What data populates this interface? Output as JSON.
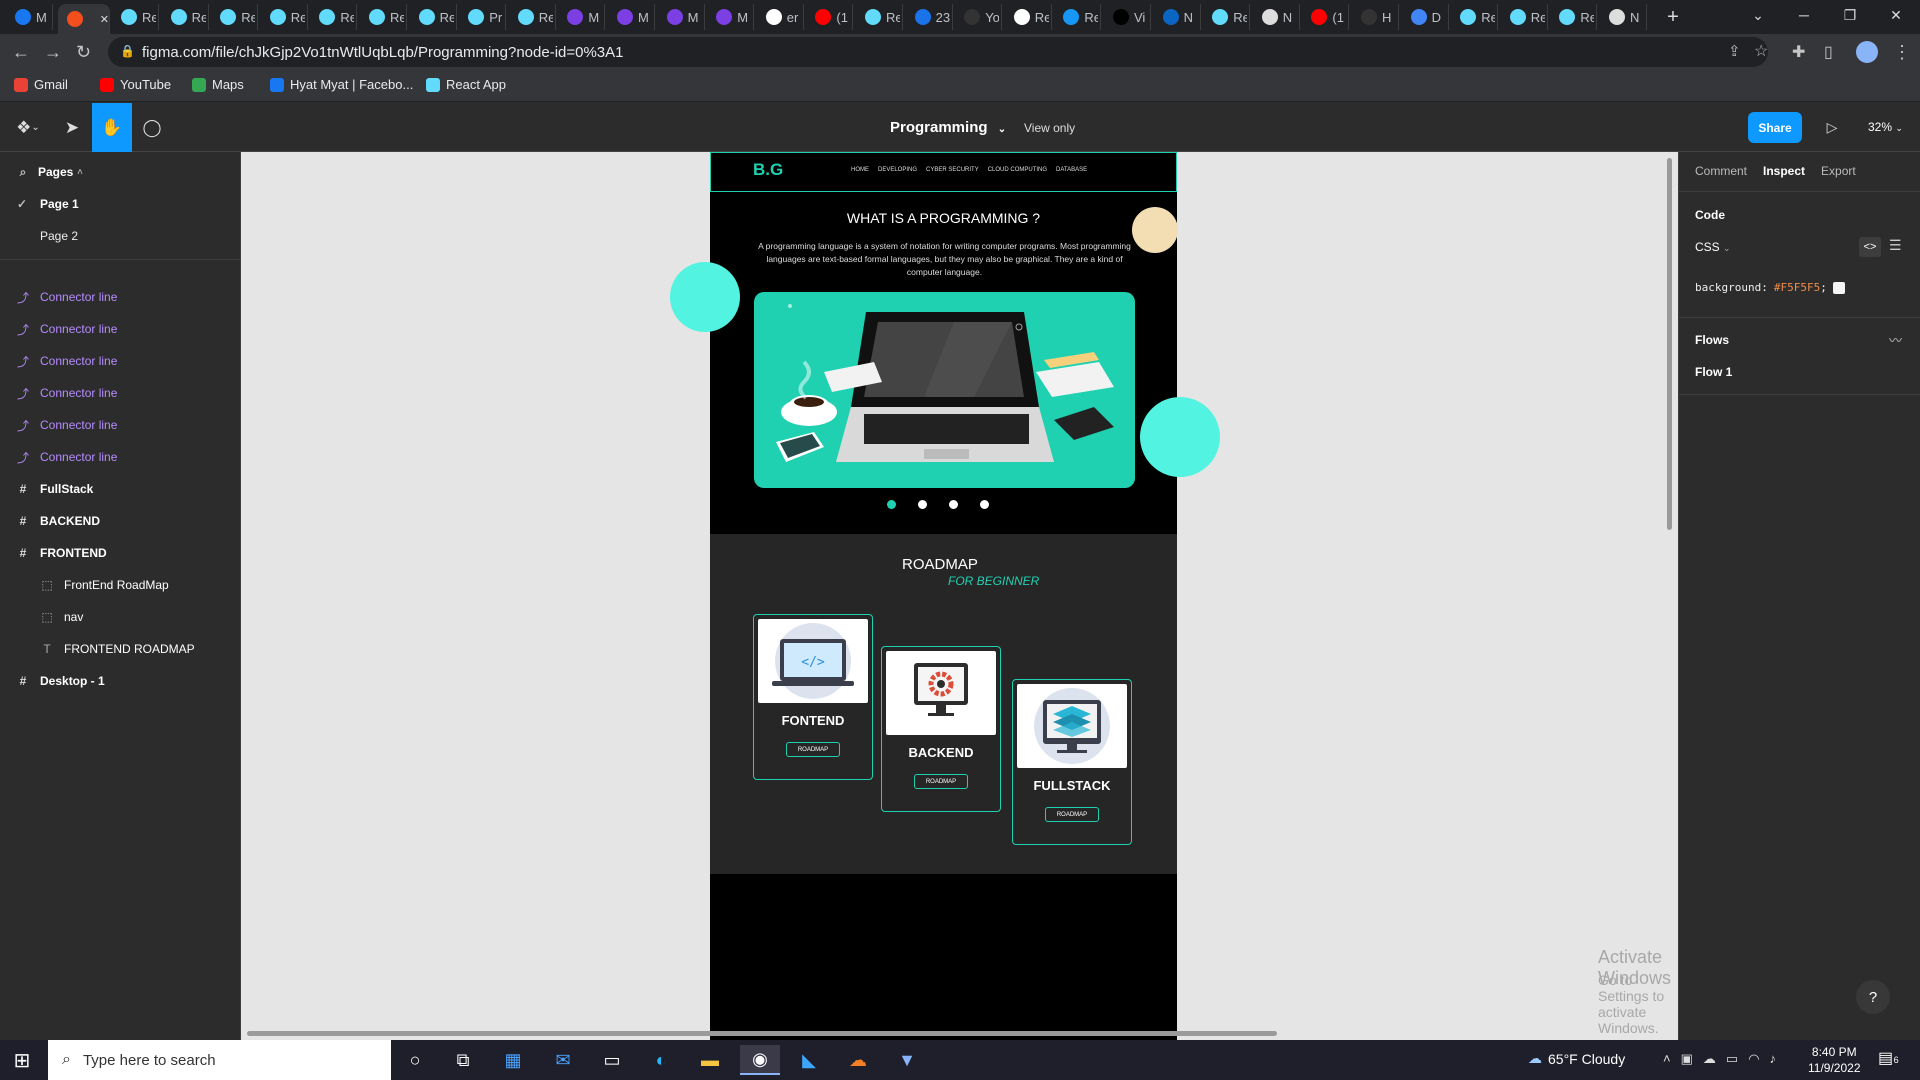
{
  "browser": {
    "tabs": [
      {
        "icon": "facebook-icon",
        "label": "M",
        "color": "#1877f2"
      },
      {
        "icon": "figma-icon",
        "label": "",
        "color": "#f24e1e",
        "active": true
      },
      {
        "icon": "react-icon",
        "label": "Re",
        "color": "#61dafb"
      },
      {
        "icon": "react-icon",
        "label": "Re",
        "color": "#61dafb"
      },
      {
        "icon": "react-icon",
        "label": "Re",
        "color": "#61dafb"
      },
      {
        "icon": "react-icon",
        "label": "Re",
        "color": "#61dafb"
      },
      {
        "icon": "react-icon",
        "label": "Re",
        "color": "#61dafb"
      },
      {
        "icon": "react-icon",
        "label": "Re",
        "color": "#61dafb"
      },
      {
        "icon": "react-icon",
        "label": "Re",
        "color": "#61dafb"
      },
      {
        "icon": "react-icon",
        "label": "Pr",
        "color": "#61dafb"
      },
      {
        "icon": "react-icon",
        "label": "Re",
        "color": "#61dafb"
      },
      {
        "icon": "list-icon",
        "label": "M",
        "color": "#7b3fe4"
      },
      {
        "icon": "list-icon",
        "label": "M",
        "color": "#7b3fe4"
      },
      {
        "icon": "list-icon",
        "label": "M",
        "color": "#7b3fe4"
      },
      {
        "icon": "list-icon",
        "label": "M",
        "color": "#7b3fe4"
      },
      {
        "icon": "google-icon",
        "label": "er",
        "color": "#ffffff"
      },
      {
        "icon": "youtube-icon",
        "label": "(1",
        "color": "#ff0000"
      },
      {
        "icon": "react-icon",
        "label": "Re",
        "color": "#61dafb"
      },
      {
        "icon": "mail-icon",
        "label": "23",
        "color": "#1a73e8"
      },
      {
        "icon": "github-icon",
        "label": "Yo",
        "color": "#333333"
      },
      {
        "icon": "google-icon",
        "label": "Re",
        "color": "#ffffff"
      },
      {
        "icon": "vuetify-icon",
        "label": "Re",
        "color": "#1697f6"
      },
      {
        "icon": "dev-icon",
        "label": "Vi",
        "color": "#000000"
      },
      {
        "icon": "linkedin-icon",
        "label": "N",
        "color": "#0a66c2"
      },
      {
        "icon": "react-icon",
        "label": "Re",
        "color": "#61dafb"
      },
      {
        "icon": "chrome-icon",
        "label": "N",
        "color": "#dddddd"
      },
      {
        "icon": "youtube-icon",
        "label": "(1",
        "color": "#ff0000"
      },
      {
        "icon": "github-icon",
        "label": "H",
        "color": "#333333"
      },
      {
        "icon": "diamond-icon",
        "label": "D",
        "color": "#4285f4"
      },
      {
        "icon": "react-icon",
        "label": "Re",
        "color": "#61dafb"
      },
      {
        "icon": "react-icon",
        "label": "Re",
        "color": "#61dafb"
      },
      {
        "icon": "react-icon",
        "label": "Re",
        "color": "#61dafb"
      },
      {
        "icon": "chrome-icon",
        "label": "N",
        "color": "#dddddd"
      }
    ],
    "url": "figma.com/file/chJkGjp2Vo1tnWtlUqbLqb/Programming?node-id=0%3A1",
    "bookmarks": [
      {
        "label": "Gmail",
        "icon": "gmail-icon",
        "color": "#ea4335"
      },
      {
        "label": "YouTube",
        "icon": "youtube-icon",
        "color": "#ff0000"
      },
      {
        "label": "Maps",
        "icon": "maps-icon",
        "color": "#34a853"
      },
      {
        "label": "Hyat Myat | Facebo...",
        "icon": "facebook-icon",
        "color": "#1877f2"
      },
      {
        "label": "React App",
        "icon": "react-icon",
        "color": "#61dafb"
      }
    ]
  },
  "figma": {
    "file_title": "Programming",
    "view_only": "View only",
    "share": "Share",
    "zoom": "32%",
    "accent": "#0d99ff",
    "pages_label": "Pages",
    "pages": [
      "Page 1",
      "Page 2"
    ],
    "layers": [
      {
        "name": "Connector line",
        "kind": "connector",
        "indent": 0
      },
      {
        "name": "Connector line",
        "kind": "connector",
        "indent": 0
      },
      {
        "name": "Connector line",
        "kind": "connector",
        "indent": 0
      },
      {
        "name": "Connector line",
        "kind": "connector",
        "indent": 0
      },
      {
        "name": "Connector line",
        "kind": "connector",
        "indent": 0
      },
      {
        "name": "Connector line",
        "kind": "connector",
        "indent": 0
      },
      {
        "name": "FullStack",
        "kind": "frame",
        "indent": 0
      },
      {
        "name": "BACKEND",
        "kind": "frame",
        "indent": 0
      },
      {
        "name": "FRONTEND",
        "kind": "frame",
        "indent": 0
      },
      {
        "name": "FrontEnd RoadMap",
        "kind": "group",
        "indent": 1
      },
      {
        "name": "nav",
        "kind": "group",
        "indent": 1
      },
      {
        "name": "FRONTEND ROADMAP",
        "kind": "text",
        "indent": 1
      },
      {
        "name": "Desktop - 1",
        "kind": "frame",
        "indent": 0
      }
    ],
    "right_tabs": [
      "Comment",
      "Inspect",
      "Export"
    ],
    "code_label": "Code",
    "code_lang": "CSS",
    "css_prop": "background:",
    "css_value": "#F5F5F5",
    "css_semicolon": ";",
    "flows_label": "Flows",
    "flow_item": "Flow 1"
  },
  "design": {
    "logo": "B.G",
    "nav": [
      "HOME",
      "DEVELOPING",
      "CYBER SECURITY",
      "CLOUD COMPUTING",
      "DATABASE"
    ],
    "hero_title": "WHAT IS A PROGRAMMING ?",
    "hero_text": "A programming language is a system of notation for writing computer programs. Most programming languages are text-based formal languages, but they may also be graphical. They are a kind of computer language.",
    "roadmap_title": "ROADMAP",
    "roadmap_sub": "FOR BEGINNER",
    "cards": [
      {
        "title": "FONTEND",
        "btn": "ROADMAP",
        "icon": "code-laptop-icon"
      },
      {
        "title": "BACKEND",
        "btn": "ROADMAP",
        "icon": "gear-monitor-icon"
      },
      {
        "title": "FULLSTACK",
        "btn": "ROADMAP",
        "icon": "layers-monitor-icon"
      }
    ],
    "teal": "#1fd1b1"
  },
  "watermark": {
    "line1": "Activate Windows",
    "line2": "Go to Settings to activate Windows."
  },
  "taskbar": {
    "search_placeholder": "Type here to search",
    "weather": "65°F  Cloudy",
    "time": "8:40 PM",
    "date": "11/9/2022",
    "notif_count": "6"
  }
}
